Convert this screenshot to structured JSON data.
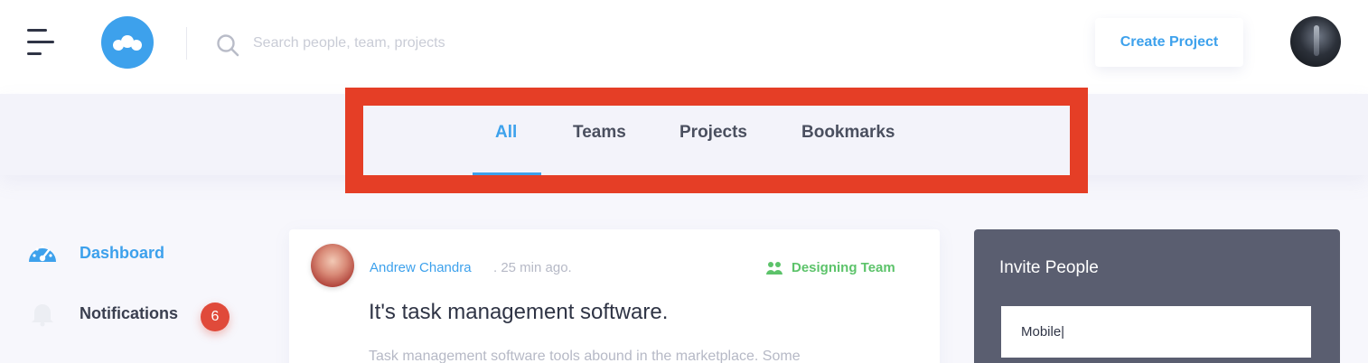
{
  "header": {
    "search": {
      "placeholder": "Search people, team, projects",
      "value": ""
    },
    "create_button_label": "Create Project"
  },
  "tabs": [
    {
      "label": "All",
      "active": true
    },
    {
      "label": "Teams",
      "active": false
    },
    {
      "label": "Projects",
      "active": false
    },
    {
      "label": "Bookmarks",
      "active": false
    }
  ],
  "sidebar": {
    "items": [
      {
        "label": "Dashboard",
        "icon": "dashboard-icon",
        "active": true
      },
      {
        "label": "Notifications",
        "icon": "bell-icon",
        "badge": "6"
      }
    ]
  },
  "post": {
    "author": "Andrew Chandra",
    "time": ". 25 min ago.",
    "team": "Designing Team",
    "title": "It's task management software.",
    "body": "Task management software tools abound in the marketplace. Some"
  },
  "invite": {
    "title": "Invite People",
    "input_value": "Mobile|"
  },
  "colors": {
    "accent": "#3da1ec",
    "highlight": "#e53e26",
    "team": "#5cc36a",
    "badge": "#e04a3a",
    "panel": "#5a5e70"
  }
}
